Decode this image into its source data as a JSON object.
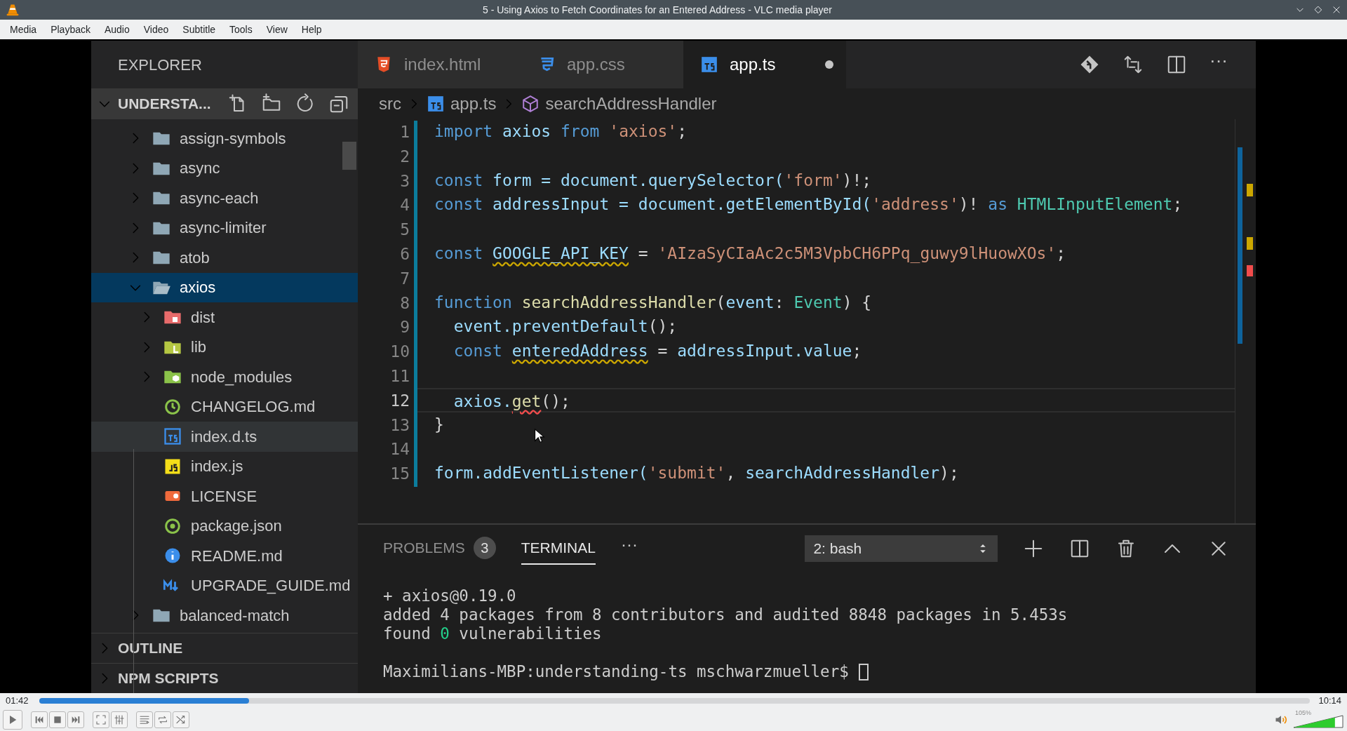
{
  "window": {
    "title": "5 - Using Axios to Fetch Coordinates for an Entered Address - VLC media player"
  },
  "menu": [
    "Media",
    "Playback",
    "Audio",
    "Video",
    "Subtitle",
    "Tools",
    "View",
    "Help"
  ],
  "editor": {
    "sidebar": {
      "title": "EXPLORER",
      "section": "UNDERSTA...",
      "tree": [
        {
          "label": "assign-symbols",
          "kind": "folder",
          "expanded": false,
          "selected": false,
          "hovered": false
        },
        {
          "label": "async",
          "kind": "folder",
          "expanded": false,
          "selected": false,
          "hovered": false
        },
        {
          "label": "async-each",
          "kind": "folder",
          "expanded": false,
          "selected": false,
          "hovered": false
        },
        {
          "label": "async-limiter",
          "kind": "folder",
          "expanded": false,
          "selected": false,
          "hovered": false
        },
        {
          "label": "atob",
          "kind": "folder",
          "expanded": false,
          "selected": false,
          "hovered": false
        },
        {
          "label": "axios",
          "kind": "folder",
          "expanded": true,
          "selected": true,
          "hovered": false,
          "children": [
            {
              "label": "dist",
              "kind": "dist-folder",
              "expanded": false,
              "selected": false,
              "hovered": false
            },
            {
              "label": "lib",
              "kind": "lib-folder",
              "expanded": false,
              "selected": false,
              "hovered": false
            },
            {
              "label": "node_modules",
              "kind": "modules-folder",
              "expanded": false,
              "selected": false,
              "hovered": false
            },
            {
              "label": "CHANGELOG.md",
              "kind": "changelog",
              "selected": false,
              "hovered": false
            },
            {
              "label": "index.d.ts",
              "kind": "ts",
              "selected": false,
              "hovered": true
            },
            {
              "label": "index.js",
              "kind": "js",
              "selected": false,
              "hovered": false
            },
            {
              "label": "LICENSE",
              "kind": "license",
              "selected": false,
              "hovered": false
            },
            {
              "label": "package.json",
              "kind": "json",
              "selected": false,
              "hovered": false
            },
            {
              "label": "README.md",
              "kind": "info",
              "selected": false,
              "hovered": false
            },
            {
              "label": "UPGRADE_GUIDE.md",
              "kind": "markdown",
              "selected": false,
              "hovered": false
            }
          ]
        },
        {
          "label": "balanced-match",
          "kind": "folder",
          "expanded": false,
          "selected": false,
          "hovered": false
        }
      ],
      "panels": [
        "OUTLINE",
        "NPM SCRIPTS"
      ]
    },
    "tabs": [
      {
        "label": "index.html",
        "kind": "html",
        "selected": false,
        "modified": false
      },
      {
        "label": "app.css",
        "kind": "css",
        "selected": false,
        "modified": false
      },
      {
        "label": "app.ts",
        "kind": "ts",
        "selected": true,
        "modified": true
      }
    ],
    "breadcrumbs": [
      {
        "label": "src",
        "kind": "folder"
      },
      {
        "label": "app.ts",
        "kind": "ts"
      },
      {
        "label": "searchAddressHandler",
        "kind": "function"
      }
    ],
    "code": [
      {
        "number": "1",
        "current": false,
        "tokens": [
          {
            "text": "import ",
            "kind": "keyword"
          },
          {
            "text": "axios ",
            "kind": "ident"
          },
          {
            "text": "from ",
            "kind": "keyword"
          },
          {
            "text": "'axios'",
            "kind": "string"
          },
          {
            "text": ";",
            "kind": "punct"
          }
        ]
      },
      {
        "number": "2",
        "current": false
      },
      {
        "number": "3",
        "current": false,
        "tokens": [
          {
            "text": "const ",
            "kind": "keyword"
          },
          {
            "text": "form = document.querySelector(",
            "kind": "ident"
          },
          {
            "text": "'form'",
            "kind": "string"
          },
          {
            "text": ")!;",
            "kind": "punct"
          }
        ]
      },
      {
        "number": "4",
        "current": false,
        "tokens": [
          {
            "text": "const ",
            "kind": "keyword"
          },
          {
            "text": "addressInput = document.getElementById(",
            "kind": "ident"
          },
          {
            "text": "'address'",
            "kind": "string"
          },
          {
            "text": ")! ",
            "kind": "punct"
          },
          {
            "text": "as ",
            "kind": "keyword"
          },
          {
            "text": "HTMLInputElement",
            "kind": "type"
          },
          {
            "text": ";",
            "kind": "punct"
          }
        ]
      },
      {
        "number": "5",
        "current": false
      },
      {
        "number": "6",
        "current": false,
        "tokens": [
          {
            "text": "const ",
            "kind": "keyword"
          },
          {
            "text": "GOOGLE_API_KEY",
            "kind": "ident-warning"
          },
          {
            "text": " = ",
            "kind": "punct"
          },
          {
            "text": "'AIzaSyCIaAc2c5M3VpbCH6PPq_guwy9lHuowXOs'",
            "kind": "string"
          },
          {
            "text": ";",
            "kind": "punct"
          }
        ]
      },
      {
        "number": "7",
        "current": false
      },
      {
        "number": "8",
        "current": false,
        "tokens": [
          {
            "text": "function ",
            "kind": "keyword"
          },
          {
            "text": "searchAddressHandler",
            "kind": "function"
          },
          {
            "text": "(",
            "kind": "punct"
          },
          {
            "text": "event",
            "kind": "ident"
          },
          {
            "text": ": ",
            "kind": "punct"
          },
          {
            "text": "Event",
            "kind": "type"
          },
          {
            "text": ") {",
            "kind": "punct"
          }
        ]
      },
      {
        "number": "9",
        "current": false,
        "tokens": [
          {
            "text": "  event.preventDefault",
            "kind": "ident"
          },
          {
            "text": "();",
            "kind": "punct"
          }
        ]
      },
      {
        "number": "10",
        "current": false,
        "tokens": [
          {
            "text": "  const ",
            "kind": "keyword"
          },
          {
            "text": "enteredAddress",
            "kind": "ident-warning"
          },
          {
            "text": " = ",
            "kind": "punct"
          },
          {
            "text": "addressInput.value",
            "kind": "ident"
          },
          {
            "text": ";",
            "kind": "punct"
          }
        ]
      },
      {
        "number": "11",
        "current": false
      },
      {
        "number": "12",
        "current": true,
        "tokens": [
          {
            "text": "  axios.",
            "kind": "ident"
          },
          {
            "text": "get",
            "kind": "function-error"
          },
          {
            "text": "();",
            "kind": "punct"
          }
        ]
      },
      {
        "number": "13",
        "current": false,
        "tokens": [
          {
            "text": "}",
            "kind": "punct"
          }
        ]
      },
      {
        "number": "14",
        "current": false
      },
      {
        "number": "15",
        "current": false,
        "tokens": [
          {
            "text": "form.addEventListener(",
            "kind": "ident"
          },
          {
            "text": "'submit'",
            "kind": "string"
          },
          {
            "text": ", ",
            "kind": "punct"
          },
          {
            "text": "searchAddressHandler",
            "kind": "ident"
          },
          {
            "text": ");",
            "kind": "punct"
          }
        ]
      }
    ],
    "panel": {
      "tabs": [
        {
          "label": "PROBLEMS",
          "badge": "3",
          "selected": false
        },
        {
          "label": "TERMINAL",
          "selected": true
        }
      ],
      "more": "···",
      "shell": "2: bash",
      "terminal": [
        [
          {
            "text": "+ axios@0.19.0",
            "kind": "plain"
          }
        ],
        [
          {
            "text": "added 4 packages from 8 contributors and audited 8848 packages in 5.453s",
            "kind": "plain"
          }
        ],
        [
          {
            "text": "found ",
            "kind": "plain"
          },
          {
            "text": "0",
            "kind": "success"
          },
          {
            "text": " vulnerabilities",
            "kind": "plain"
          }
        ]
      ],
      "prompt": "Maximilians-MBP:understanding-ts mschwarzmueller$"
    },
    "more_actions": "···"
  },
  "player": {
    "elapsed": "01:42",
    "duration": "10:14",
    "level": 0.165,
    "volume": {
      "reading": "105%",
      "level": 0.84
    }
  }
}
